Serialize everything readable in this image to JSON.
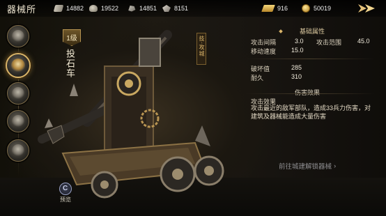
{
  "header": {
    "title": "器械所",
    "resources": [
      {
        "icon": "wood-icon",
        "value": "14882"
      },
      {
        "icon": "food-icon",
        "value": "19522"
      },
      {
        "icon": "stone-icon",
        "value": "14851"
      },
      {
        "icon": "iron-icon",
        "value": "8151"
      }
    ],
    "currencies": [
      {
        "icon": "gold-bar-icon",
        "value": "916"
      },
      {
        "icon": "coin-icon",
        "value": "50019"
      }
    ]
  },
  "unit": {
    "level": "1级",
    "name": "投石车",
    "tag": "技·攻城"
  },
  "stats": {
    "basic_title": "基础属性",
    "attack_interval_label": "攻击间隔",
    "attack_interval_value": "3.0",
    "attack_range_label": "攻击范围",
    "attack_range_value": "45.0",
    "move_speed_label": "移动速度",
    "move_speed_value": "15.0",
    "destroy_label": "破坏值",
    "destroy_value": "285",
    "durability_label": "耐久",
    "durability_value": "310",
    "damage_title": "伤害效果",
    "effect_title": "攻击效果",
    "effect_desc": "攻击最近的敌军部队，造成33兵力伤害，对建筑及器械能造成大量伤害"
  },
  "actions": {
    "goto_label": "前往城建解锁器械",
    "preview_label": "预览"
  },
  "colors": {
    "accent_gold": "#d9b468",
    "text_light": "#e8dcc0",
    "muted_link": "#8f8f92"
  }
}
